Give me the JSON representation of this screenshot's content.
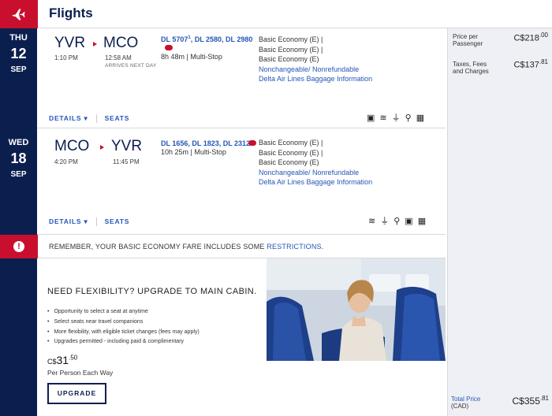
{
  "header": {
    "title": "Flights",
    "icon": "airplane-icon",
    "accent": "#c8102e",
    "navy": "#0b1f4f"
  },
  "outbound": {
    "dow": "THU",
    "day": "12",
    "month": "SEP",
    "from": "YVR",
    "to": "MCO",
    "depart_time": "1:10 PM",
    "arrive_time": "12:58 AM",
    "arrive_note": "ARRIVES NEXT DAY",
    "flights": "DL 5707",
    "flights_sup": "1",
    "flights_rest": ", DL 2580, DL 2980",
    "duration": "8h 48m | Multi-Stop",
    "fare1": "Basic Economy (E) |",
    "fare2": "Basic Economy (E) |",
    "fare3": "Basic Economy (E)",
    "nonchange": "Nonchangeable/ Nonrefundable",
    "baggage": "Delta Air Lines Baggage Information",
    "details": "DETAILS ▾",
    "seats": "SEATS"
  },
  "return": {
    "dow": "WED",
    "day": "18",
    "month": "SEP",
    "from": "MCO",
    "to": "YVR",
    "depart_time": "4:20 PM",
    "arrive_time": "11:45 PM",
    "flights": "DL 1656, DL 1823, DL 2312",
    "duration": "10h 25m | Multi-Stop",
    "fare1": "Basic Economy (E) |",
    "fare2": "Basic Economy (E) |",
    "fare3": "Basic Economy (E)",
    "nonchange": "Nonchangeable/ Nonrefundable",
    "baggage": "Delta Air Lines Baggage Information",
    "details": "DETAILS ▾",
    "seats": "SEATS"
  },
  "alert": {
    "text": "REMEMBER, YOUR BASIC ECONOMY FARE INCLUDES SOME ",
    "link": "RESTRICTIONS",
    "end": "."
  },
  "upsell": {
    "title": "NEED FLEXIBILITY? UPGRADE TO MAIN CABIN.",
    "bullets": [
      "Opportunity to select a seat at anytime",
      "Select seats near travel companions",
      "More flexibility, with eligible ticket changes (fees may apply)",
      "Upgrades permitted - including paid & complimentary"
    ],
    "currency": "C$",
    "price": "31",
    "cents": ".50",
    "per": "Per Person Each Way",
    "button": "UPGRADE"
  },
  "prices": {
    "per_passenger_label": "Price per Passenger",
    "per_passenger_cur": "C$",
    "per_passenger": "218",
    "per_passenger_cents": ".00",
    "taxes_label": "Taxes, Fees and Charges",
    "taxes_cur": "C$",
    "taxes": "137",
    "taxes_cents": ".81",
    "total_label": "Total Price",
    "total_sub": "(CAD)",
    "total_cur": "C$",
    "total": "355",
    "total_cents": ".81"
  }
}
